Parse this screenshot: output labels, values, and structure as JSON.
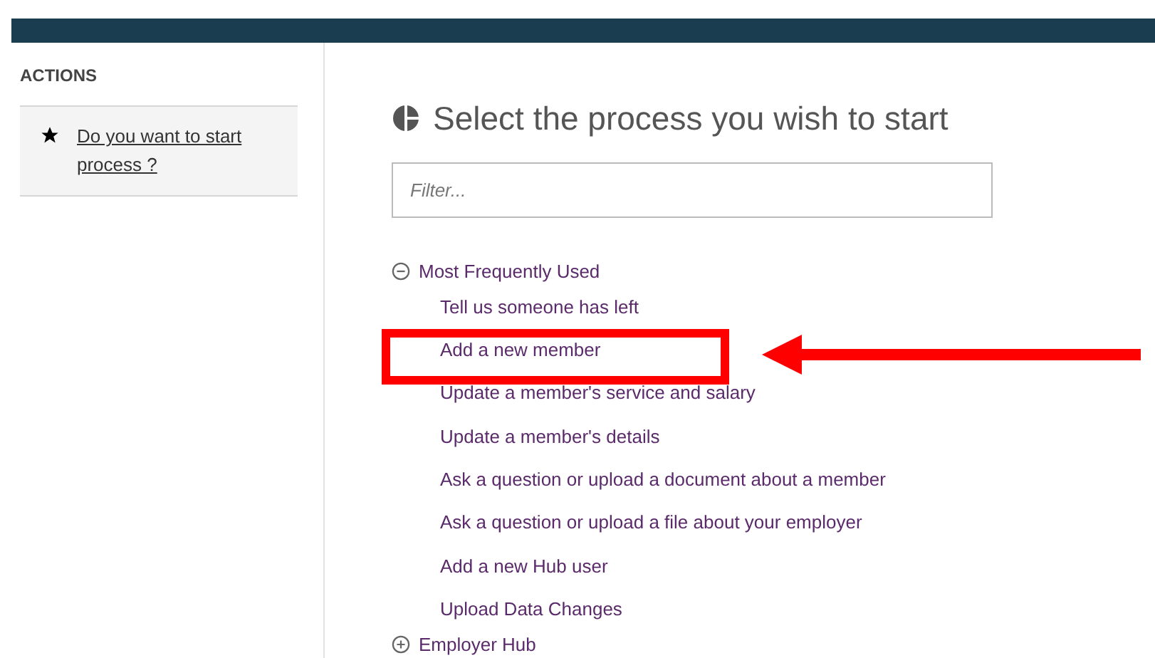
{
  "sidebar": {
    "title": "ACTIONS",
    "items": [
      {
        "label": "Do you want to start process ?"
      }
    ]
  },
  "main": {
    "title": "Select the process you wish to start",
    "filter": {
      "placeholder": "Filter..."
    },
    "groups": [
      {
        "label": "Most Frequently Used",
        "expanded": true,
        "items": [
          {
            "label": "Tell us someone has left",
            "highlighted": false
          },
          {
            "label": "Add a new member",
            "highlighted": true
          },
          {
            "label": "Update a member's service and salary",
            "highlighted": false
          },
          {
            "label": "Update a member's details",
            "highlighted": false
          },
          {
            "label": "Ask a question or upload a document about a member",
            "highlighted": false
          },
          {
            "label": "Ask a question or upload a file about your employer",
            "highlighted": false
          },
          {
            "label": "Add a new Hub user",
            "highlighted": false
          },
          {
            "label": "Upload Data Changes",
            "highlighted": false
          }
        ]
      },
      {
        "label": "Employer Hub",
        "expanded": false
      }
    ]
  },
  "pointer_arrow": true
}
